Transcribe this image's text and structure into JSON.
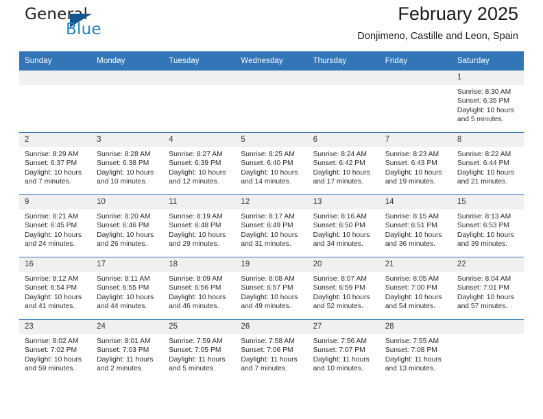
{
  "brand": {
    "name_part1": "General",
    "name_part2": "Blue",
    "triangle_icon": "blue-triangle-icon",
    "accent_color": "#1f7fc4",
    "dark_color": "#14578f"
  },
  "header": {
    "title": "February 2025",
    "subtitle": "Donjimeno, Castille and Leon, Spain"
  },
  "calendar": {
    "header_bg": "#3276b8",
    "daynum_bg": "#f0f0f0",
    "weekdays": [
      "Sunday",
      "Monday",
      "Tuesday",
      "Wednesday",
      "Thursday",
      "Friday",
      "Saturday"
    ],
    "weeks": [
      [
        {
          "day": "",
          "empty": true
        },
        {
          "day": "",
          "empty": true
        },
        {
          "day": "",
          "empty": true
        },
        {
          "day": "",
          "empty": true
        },
        {
          "day": "",
          "empty": true
        },
        {
          "day": "",
          "empty": true
        },
        {
          "day": "1",
          "sunrise": "Sunrise: 8:30 AM",
          "sunset": "Sunset: 6:35 PM",
          "daylight1": "Daylight: 10 hours",
          "daylight2": "and 5 minutes."
        }
      ],
      [
        {
          "day": "2",
          "sunrise": "Sunrise: 8:29 AM",
          "sunset": "Sunset: 6:37 PM",
          "daylight1": "Daylight: 10 hours",
          "daylight2": "and 7 minutes."
        },
        {
          "day": "3",
          "sunrise": "Sunrise: 8:28 AM",
          "sunset": "Sunset: 6:38 PM",
          "daylight1": "Daylight: 10 hours",
          "daylight2": "and 10 minutes."
        },
        {
          "day": "4",
          "sunrise": "Sunrise: 8:27 AM",
          "sunset": "Sunset: 6:39 PM",
          "daylight1": "Daylight: 10 hours",
          "daylight2": "and 12 minutes."
        },
        {
          "day": "5",
          "sunrise": "Sunrise: 8:25 AM",
          "sunset": "Sunset: 6:40 PM",
          "daylight1": "Daylight: 10 hours",
          "daylight2": "and 14 minutes."
        },
        {
          "day": "6",
          "sunrise": "Sunrise: 8:24 AM",
          "sunset": "Sunset: 6:42 PM",
          "daylight1": "Daylight: 10 hours",
          "daylight2": "and 17 minutes."
        },
        {
          "day": "7",
          "sunrise": "Sunrise: 8:23 AM",
          "sunset": "Sunset: 6:43 PM",
          "daylight1": "Daylight: 10 hours",
          "daylight2": "and 19 minutes."
        },
        {
          "day": "8",
          "sunrise": "Sunrise: 8:22 AM",
          "sunset": "Sunset: 6:44 PM",
          "daylight1": "Daylight: 10 hours",
          "daylight2": "and 21 minutes."
        }
      ],
      [
        {
          "day": "9",
          "sunrise": "Sunrise: 8:21 AM",
          "sunset": "Sunset: 6:45 PM",
          "daylight1": "Daylight: 10 hours",
          "daylight2": "and 24 minutes."
        },
        {
          "day": "10",
          "sunrise": "Sunrise: 8:20 AM",
          "sunset": "Sunset: 6:46 PM",
          "daylight1": "Daylight: 10 hours",
          "daylight2": "and 26 minutes."
        },
        {
          "day": "11",
          "sunrise": "Sunrise: 8:19 AM",
          "sunset": "Sunset: 6:48 PM",
          "daylight1": "Daylight: 10 hours",
          "daylight2": "and 29 minutes."
        },
        {
          "day": "12",
          "sunrise": "Sunrise: 8:17 AM",
          "sunset": "Sunset: 6:49 PM",
          "daylight1": "Daylight: 10 hours",
          "daylight2": "and 31 minutes."
        },
        {
          "day": "13",
          "sunrise": "Sunrise: 8:16 AM",
          "sunset": "Sunset: 6:50 PM",
          "daylight1": "Daylight: 10 hours",
          "daylight2": "and 34 minutes."
        },
        {
          "day": "14",
          "sunrise": "Sunrise: 8:15 AM",
          "sunset": "Sunset: 6:51 PM",
          "daylight1": "Daylight: 10 hours",
          "daylight2": "and 36 minutes."
        },
        {
          "day": "15",
          "sunrise": "Sunrise: 8:13 AM",
          "sunset": "Sunset: 6:53 PM",
          "daylight1": "Daylight: 10 hours",
          "daylight2": "and 39 minutes."
        }
      ],
      [
        {
          "day": "16",
          "sunrise": "Sunrise: 8:12 AM",
          "sunset": "Sunset: 6:54 PM",
          "daylight1": "Daylight: 10 hours",
          "daylight2": "and 41 minutes."
        },
        {
          "day": "17",
          "sunrise": "Sunrise: 8:11 AM",
          "sunset": "Sunset: 6:55 PM",
          "daylight1": "Daylight: 10 hours",
          "daylight2": "and 44 minutes."
        },
        {
          "day": "18",
          "sunrise": "Sunrise: 8:09 AM",
          "sunset": "Sunset: 6:56 PM",
          "daylight1": "Daylight: 10 hours",
          "daylight2": "and 46 minutes."
        },
        {
          "day": "19",
          "sunrise": "Sunrise: 8:08 AM",
          "sunset": "Sunset: 6:57 PM",
          "daylight1": "Daylight: 10 hours",
          "daylight2": "and 49 minutes."
        },
        {
          "day": "20",
          "sunrise": "Sunrise: 8:07 AM",
          "sunset": "Sunset: 6:59 PM",
          "daylight1": "Daylight: 10 hours",
          "daylight2": "and 52 minutes."
        },
        {
          "day": "21",
          "sunrise": "Sunrise: 8:05 AM",
          "sunset": "Sunset: 7:00 PM",
          "daylight1": "Daylight: 10 hours",
          "daylight2": "and 54 minutes."
        },
        {
          "day": "22",
          "sunrise": "Sunrise: 8:04 AM",
          "sunset": "Sunset: 7:01 PM",
          "daylight1": "Daylight: 10 hours",
          "daylight2": "and 57 minutes."
        }
      ],
      [
        {
          "day": "23",
          "sunrise": "Sunrise: 8:02 AM",
          "sunset": "Sunset: 7:02 PM",
          "daylight1": "Daylight: 10 hours",
          "daylight2": "and 59 minutes."
        },
        {
          "day": "24",
          "sunrise": "Sunrise: 8:01 AM",
          "sunset": "Sunset: 7:03 PM",
          "daylight1": "Daylight: 11 hours",
          "daylight2": "and 2 minutes."
        },
        {
          "day": "25",
          "sunrise": "Sunrise: 7:59 AM",
          "sunset": "Sunset: 7:05 PM",
          "daylight1": "Daylight: 11 hours",
          "daylight2": "and 5 minutes."
        },
        {
          "day": "26",
          "sunrise": "Sunrise: 7:58 AM",
          "sunset": "Sunset: 7:06 PM",
          "daylight1": "Daylight: 11 hours",
          "daylight2": "and 7 minutes."
        },
        {
          "day": "27",
          "sunrise": "Sunrise: 7:56 AM",
          "sunset": "Sunset: 7:07 PM",
          "daylight1": "Daylight: 11 hours",
          "daylight2": "and 10 minutes."
        },
        {
          "day": "28",
          "sunrise": "Sunrise: 7:55 AM",
          "sunset": "Sunset: 7:08 PM",
          "daylight1": "Daylight: 11 hours",
          "daylight2": "and 13 minutes."
        },
        {
          "day": "",
          "empty": true
        }
      ]
    ]
  }
}
